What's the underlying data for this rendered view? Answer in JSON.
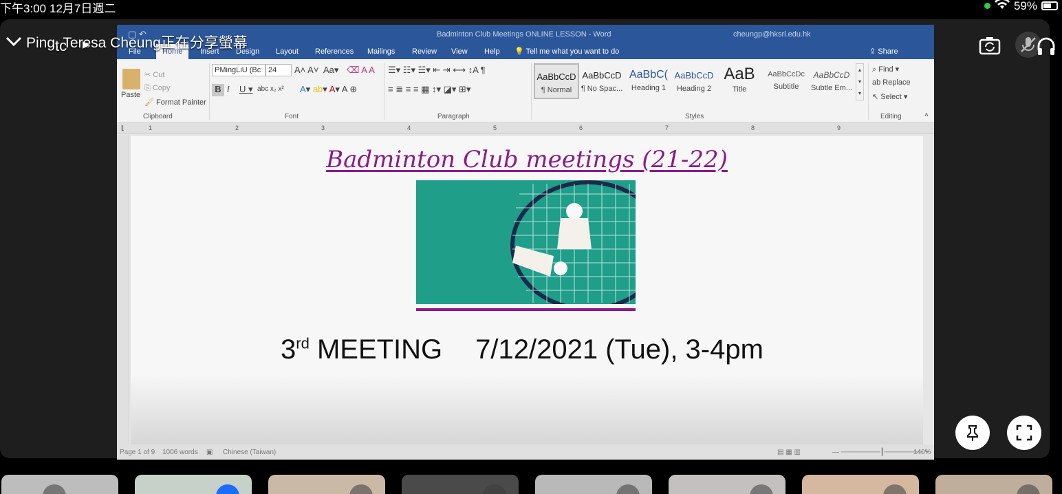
{
  "status_bar": {
    "time": "下午3:00",
    "date": "12月7日週二",
    "battery": "59%"
  },
  "meeting": {
    "sharer_banner": "Ping, Teresa Cheung正在分享螢幕",
    "self_initials": "tc",
    "icons": [
      "chevron-down-icon",
      "camera-switch-icon",
      "mic-muted-icon",
      "headphones-icon",
      "pin-icon",
      "fullscreen-icon"
    ]
  },
  "word": {
    "title": "Badminton Club Meetings ONLINE LESSON  -  Word",
    "account": "cheungp@hksrl.edu.hk",
    "tabs": [
      "File",
      "Home",
      "Insert",
      "Design",
      "Layout",
      "References",
      "Mailings",
      "Review",
      "View",
      "Help"
    ],
    "active_tab": "Home",
    "tell_me": "Tell me what you want to do",
    "share": "Share",
    "clipboard": {
      "paste": "Paste",
      "cut": "Cut",
      "copy": "Copy",
      "format_painter": "Format Painter",
      "label": "Clipboard"
    },
    "font": {
      "name": "PMingLiU (Bc",
      "size": "24",
      "label": "Font"
    },
    "paragraph_label": "Paragraph",
    "styles": [
      {
        "preview": "AaBbCcD",
        "name": "¶ Normal"
      },
      {
        "preview": "AaBbCcD",
        "name": "¶ No Spac..."
      },
      {
        "preview": "AaBbC(",
        "name": "Heading 1"
      },
      {
        "preview": "AaBbCcD",
        "name": "Heading 2"
      },
      {
        "preview": "AaB",
        "name": "Title"
      },
      {
        "preview": "AaBbCcDc",
        "name": "Subtitle"
      },
      {
        "preview": "AaBbCcD",
        "name": "Subtle Em..."
      }
    ],
    "styles_label": "Styles",
    "editing": {
      "find": "Find",
      "replace": "Replace",
      "select": "Select",
      "label": "Editing"
    },
    "ruler_numbers": [
      "1",
      "2",
      "3",
      "4",
      "5",
      "6",
      "7",
      "8",
      "9"
    ],
    "document": {
      "heading": "Badminton Club meetings (21-22)",
      "meeting_ordinal": "3",
      "meeting_suffix": "rd",
      "meeting_word": "MEETING",
      "meeting_date": "7/12/2021 (Tue), 3-4pm"
    },
    "statusbar": {
      "page": "Page 1 of 9",
      "words": "1006 words",
      "language": "Chinese (Taiwan)",
      "zoom": "140%"
    }
  }
}
